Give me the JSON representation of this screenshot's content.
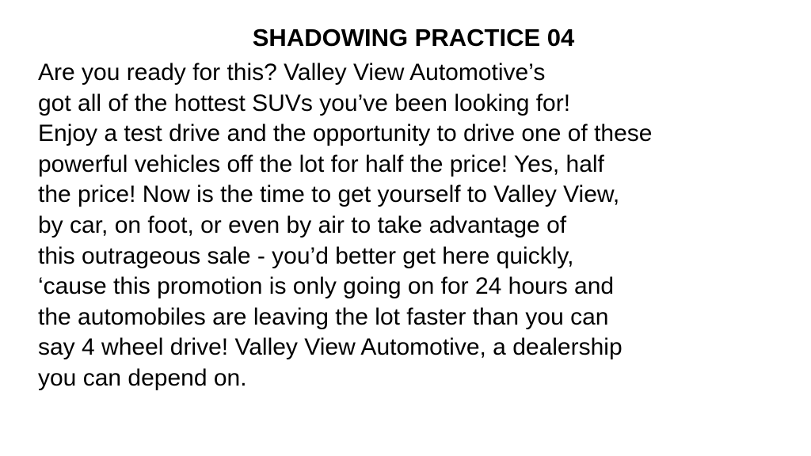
{
  "title": "SHADOWING PRACTICE 04",
  "lines": [
    "Are you ready for this? Valley View Automotive’s",
    "got all of the hottest SUVs you’ve been looking for!",
    "Enjoy a test drive and the opportunity to drive one of these",
    "powerful vehicles off the lot for half the price! Yes, half",
    "the price! Now is the time to get yourself to Valley View,",
    "by car, on foot, or even by air to take advantage of",
    "this outrageous sale - you’d better get here quickly,",
    "‘cause this promotion is only going on for 24 hours and",
    "the automobiles are leaving the lot faster than you can",
    "say 4 wheel drive! Valley View Automotive, a dealership",
    "you can depend on."
  ]
}
